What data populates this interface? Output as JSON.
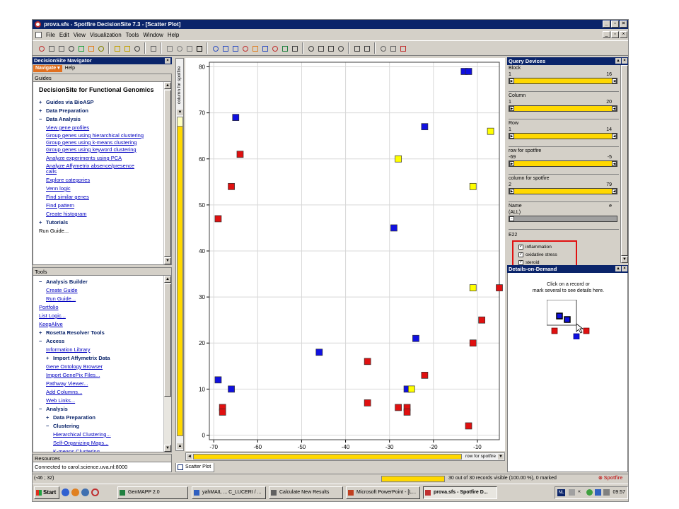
{
  "window": {
    "title": "prova.sfs - Spotfire DecisionSite 7.3 - [Scatter Plot]",
    "minimize": "_",
    "restore": "▫",
    "close": "×"
  },
  "menubar": [
    "File",
    "Edit",
    "View",
    "Visualization",
    "Tools",
    "Window",
    "Help"
  ],
  "toolbar_icons": [
    "stop-icon",
    "back-icon",
    "forward-icon",
    "delete-icon",
    "refresh-icon",
    "navigator-icon",
    "home-icon",
    "open-icon",
    "save-as-icon",
    "save-icon",
    "print-icon",
    "copy-icon",
    "paste-icon",
    "zoom-icon",
    "whats-this-icon",
    "scatter-plot-icon",
    "scatter-3d-icon",
    "bar-chart-icon",
    "histogram-icon",
    "pie-chart-icon",
    "profile-chart-icon",
    "line-chart-icon",
    "heat-map-icon",
    "table-icon",
    "layout-icon",
    "tile-icon",
    "split-icon",
    "arrange-icon",
    "properties-icon",
    "legend-icon",
    "new-window-icon",
    "export-icon",
    "exit-icon"
  ],
  "navigator": {
    "title": "DecisionSite Navigator",
    "navigate_label": "Navigate ▾",
    "help_label": "Help",
    "guides_title": "Guides",
    "guides_heading": "DecisionSite for Functional Genomics",
    "guides": [
      {
        "text": "Guides via BioASP",
        "kind": "top",
        "bullet": "+"
      },
      {
        "text": "Data Preparation",
        "kind": "top",
        "bullet": "+"
      },
      {
        "text": "Data Analysis",
        "kind": "top",
        "bullet": "−"
      },
      {
        "text": "View gene profiles",
        "kind": "link"
      },
      {
        "text": "Group genes using hierarchical clustering",
        "kind": "link"
      },
      {
        "text": "Group genes using k-means clustering",
        "kind": "link"
      },
      {
        "text": "Group genes using keyword clustering",
        "kind": "link"
      },
      {
        "text": "Analyze experiments using PCA",
        "kind": "link"
      },
      {
        "text": "Analyze Affymetrix absence/presence calls",
        "kind": "link"
      },
      {
        "text": "Explore categories",
        "kind": "link"
      },
      {
        "text": "Venn logic",
        "kind": "link"
      },
      {
        "text": "Find similar genes",
        "kind": "link"
      },
      {
        "text": "Find pattern",
        "kind": "link"
      },
      {
        "text": "Create histogram",
        "kind": "link"
      },
      {
        "text": "Tutorials",
        "kind": "top",
        "bullet": "+"
      },
      {
        "text": "Run Guide...",
        "kind": "plainlink"
      }
    ],
    "tools_title": "Tools",
    "tools": [
      {
        "text": "Analysis Builder",
        "kind": "top",
        "bullet": "−",
        "indent": 0
      },
      {
        "text": "Create Guide",
        "kind": "link",
        "indent": 1
      },
      {
        "text": "Run Guide...",
        "kind": "link",
        "indent": 1
      },
      {
        "text": "Portfolio",
        "kind": "link",
        "indent": 0
      },
      {
        "text": "List Logic...",
        "kind": "link",
        "indent": 0
      },
      {
        "text": "KeepAlive",
        "kind": "link",
        "indent": 0
      },
      {
        "text": "Rosetta Resolver Tools",
        "kind": "top",
        "bullet": "+",
        "indent": 0
      },
      {
        "text": "Access",
        "kind": "top",
        "bullet": "−",
        "indent": 0
      },
      {
        "text": "Information Library",
        "kind": "link",
        "indent": 1
      },
      {
        "text": "Import Affymetrix Data",
        "kind": "sub",
        "bullet": "+",
        "indent": 1
      },
      {
        "text": "Gene Ontology Browser",
        "kind": "link",
        "indent": 1
      },
      {
        "text": "Import GenePix Files...",
        "kind": "link",
        "indent": 1
      },
      {
        "text": "Pathway Viewer...",
        "kind": "link",
        "indent": 1
      },
      {
        "text": "Add Columns...",
        "kind": "link",
        "indent": 1
      },
      {
        "text": "Web Links...",
        "kind": "link",
        "indent": 1
      },
      {
        "text": "Analysis",
        "kind": "top",
        "bullet": "−",
        "indent": 0
      },
      {
        "text": "Data Preparation",
        "kind": "sub",
        "bullet": "+",
        "indent": 1
      },
      {
        "text": "Clustering",
        "kind": "sub",
        "bullet": "−",
        "indent": 1
      },
      {
        "text": "Hierarchical Clustering...",
        "kind": "link",
        "indent": 2
      },
      {
        "text": "Self-Organizing Maps...",
        "kind": "link",
        "indent": 2
      },
      {
        "text": "K-means Clustering...",
        "kind": "link",
        "indent": 2
      }
    ],
    "resources_title": "Resources",
    "connection": "Connected to carol.science.uva.nl:8000"
  },
  "plot": {
    "y_column": "column for spotfire",
    "x_column": "row for spotfire",
    "tab_label": "Scatter Plot"
  },
  "chart_data": {
    "type": "scatter",
    "title": "",
    "xlabel": "row for spotfire",
    "ylabel": "column for spotfire",
    "xlim": [
      -71,
      -5
    ],
    "ylim": [
      -1,
      81
    ],
    "xticks": [
      -70,
      -60,
      -50,
      -40,
      -30,
      -20,
      -10
    ],
    "yticks": [
      0,
      10,
      20,
      30,
      40,
      50,
      60,
      70,
      80
    ],
    "grid": true,
    "colors": {
      "red": "#e01010",
      "blue": "#1010e0",
      "yellow": "#ffff00"
    },
    "points": [
      {
        "x": -65,
        "y": 69,
        "c": "blue"
      },
      {
        "x": -13,
        "y": 79,
        "c": "blue"
      },
      {
        "x": -12,
        "y": 79,
        "c": "blue"
      },
      {
        "x": -22,
        "y": 67,
        "c": "blue"
      },
      {
        "x": -7,
        "y": 66,
        "c": "yellow"
      },
      {
        "x": -64,
        "y": 61,
        "c": "red"
      },
      {
        "x": -28,
        "y": 60,
        "c": "yellow"
      },
      {
        "x": -66,
        "y": 54,
        "c": "red"
      },
      {
        "x": -11,
        "y": 54,
        "c": "yellow"
      },
      {
        "x": -69,
        "y": 47,
        "c": "red"
      },
      {
        "x": -29,
        "y": 45,
        "c": "blue"
      },
      {
        "x": -11,
        "y": 32,
        "c": "yellow"
      },
      {
        "x": -5,
        "y": 32,
        "c": "red"
      },
      {
        "x": -9,
        "y": 25,
        "c": "red"
      },
      {
        "x": -24,
        "y": 21,
        "c": "blue"
      },
      {
        "x": -11,
        "y": 20,
        "c": "red"
      },
      {
        "x": -46,
        "y": 18,
        "c": "blue"
      },
      {
        "x": -35,
        "y": 16,
        "c": "red"
      },
      {
        "x": -22,
        "y": 13,
        "c": "red"
      },
      {
        "x": -69,
        "y": 12,
        "c": "blue"
      },
      {
        "x": -66,
        "y": 10,
        "c": "blue"
      },
      {
        "x": -26,
        "y": 10,
        "c": "blue"
      },
      {
        "x": -25,
        "y": 10,
        "c": "yellow"
      },
      {
        "x": -35,
        "y": 7,
        "c": "red"
      },
      {
        "x": -68,
        "y": 6,
        "c": "red"
      },
      {
        "x": -68,
        "y": 5,
        "c": "red"
      },
      {
        "x": -28,
        "y": 6,
        "c": "red"
      },
      {
        "x": -26,
        "y": 6,
        "c": "red"
      },
      {
        "x": -26,
        "y": 5,
        "c": "red"
      },
      {
        "x": -12,
        "y": 2,
        "c": "red"
      }
    ]
  },
  "query_devices": {
    "title": "Query Devices",
    "devices": [
      {
        "name": "Block",
        "min": "1",
        "max": "16"
      },
      {
        "name": "Column",
        "min": "1",
        "max": "20"
      },
      {
        "name": "Row",
        "min": "1",
        "max": "14"
      },
      {
        "name": "row for spotfire",
        "min": "-69",
        "max": "-5"
      },
      {
        "name": "column for spotfire",
        "min": "2",
        "max": "79"
      }
    ],
    "name_device": {
      "name": "Name",
      "value": "(ALL)",
      "right": "e"
    },
    "partial_label": "E22",
    "checkboxes": [
      {
        "label": "inflammation",
        "checked": "✓"
      },
      {
        "label": "oxidative stress",
        "checked": "✓"
      },
      {
        "label": "steroid",
        "checked": "✓"
      }
    ]
  },
  "details": {
    "title": "Details-on-Demand",
    "message_line1": "Click on a record or",
    "message_line2": "mark several to see details here."
  },
  "status": {
    "coords": "(-46 ; 32)",
    "visible": "30 out of 30 records visible (100.00 %), 0 marked",
    "brand": "⊗ Spotfire"
  },
  "taskbar": {
    "start": "Start",
    "tasks": [
      {
        "label": "GenMAPP 2.0"
      },
      {
        "label": "yahMAIL ... C_LUCERI / ..."
      },
      {
        "label": "Calculate New Results"
      },
      {
        "label": "Microsoft PowerPoint - [L..."
      },
      {
        "label": "prova.sfs - Spotfire D...",
        "active": true
      }
    ],
    "lang": "NL",
    "clock": "09:57"
  }
}
